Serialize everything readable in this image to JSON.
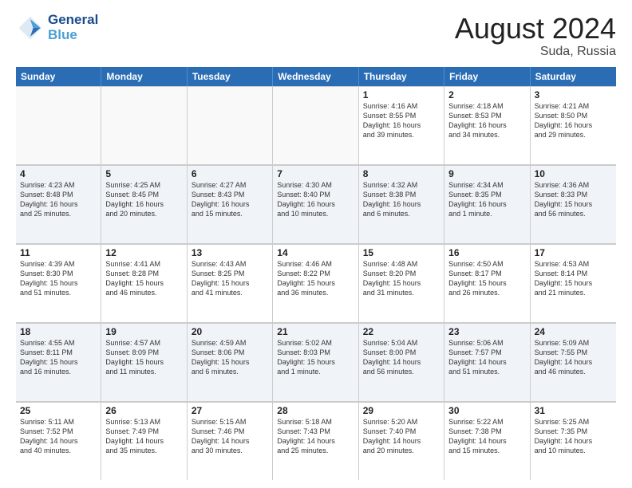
{
  "header": {
    "logo_line1": "General",
    "logo_line2": "Blue",
    "month_title": "August 2024",
    "location": "Suda, Russia"
  },
  "weekdays": [
    "Sunday",
    "Monday",
    "Tuesday",
    "Wednesday",
    "Thursday",
    "Friday",
    "Saturday"
  ],
  "rows": [
    [
      {
        "day": "",
        "info": ""
      },
      {
        "day": "",
        "info": ""
      },
      {
        "day": "",
        "info": ""
      },
      {
        "day": "",
        "info": ""
      },
      {
        "day": "1",
        "info": "Sunrise: 4:16 AM\nSunset: 8:55 PM\nDaylight: 16 hours\nand 39 minutes."
      },
      {
        "day": "2",
        "info": "Sunrise: 4:18 AM\nSunset: 8:53 PM\nDaylight: 16 hours\nand 34 minutes."
      },
      {
        "day": "3",
        "info": "Sunrise: 4:21 AM\nSunset: 8:50 PM\nDaylight: 16 hours\nand 29 minutes."
      }
    ],
    [
      {
        "day": "4",
        "info": "Sunrise: 4:23 AM\nSunset: 8:48 PM\nDaylight: 16 hours\nand 25 minutes."
      },
      {
        "day": "5",
        "info": "Sunrise: 4:25 AM\nSunset: 8:45 PM\nDaylight: 16 hours\nand 20 minutes."
      },
      {
        "day": "6",
        "info": "Sunrise: 4:27 AM\nSunset: 8:43 PM\nDaylight: 16 hours\nand 15 minutes."
      },
      {
        "day": "7",
        "info": "Sunrise: 4:30 AM\nSunset: 8:40 PM\nDaylight: 16 hours\nand 10 minutes."
      },
      {
        "day": "8",
        "info": "Sunrise: 4:32 AM\nSunset: 8:38 PM\nDaylight: 16 hours\nand 6 minutes."
      },
      {
        "day": "9",
        "info": "Sunrise: 4:34 AM\nSunset: 8:35 PM\nDaylight: 16 hours\nand 1 minute."
      },
      {
        "day": "10",
        "info": "Sunrise: 4:36 AM\nSunset: 8:33 PM\nDaylight: 15 hours\nand 56 minutes."
      }
    ],
    [
      {
        "day": "11",
        "info": "Sunrise: 4:39 AM\nSunset: 8:30 PM\nDaylight: 15 hours\nand 51 minutes."
      },
      {
        "day": "12",
        "info": "Sunrise: 4:41 AM\nSunset: 8:28 PM\nDaylight: 15 hours\nand 46 minutes."
      },
      {
        "day": "13",
        "info": "Sunrise: 4:43 AM\nSunset: 8:25 PM\nDaylight: 15 hours\nand 41 minutes."
      },
      {
        "day": "14",
        "info": "Sunrise: 4:46 AM\nSunset: 8:22 PM\nDaylight: 15 hours\nand 36 minutes."
      },
      {
        "day": "15",
        "info": "Sunrise: 4:48 AM\nSunset: 8:20 PM\nDaylight: 15 hours\nand 31 minutes."
      },
      {
        "day": "16",
        "info": "Sunrise: 4:50 AM\nSunset: 8:17 PM\nDaylight: 15 hours\nand 26 minutes."
      },
      {
        "day": "17",
        "info": "Sunrise: 4:53 AM\nSunset: 8:14 PM\nDaylight: 15 hours\nand 21 minutes."
      }
    ],
    [
      {
        "day": "18",
        "info": "Sunrise: 4:55 AM\nSunset: 8:11 PM\nDaylight: 15 hours\nand 16 minutes."
      },
      {
        "day": "19",
        "info": "Sunrise: 4:57 AM\nSunset: 8:09 PM\nDaylight: 15 hours\nand 11 minutes."
      },
      {
        "day": "20",
        "info": "Sunrise: 4:59 AM\nSunset: 8:06 PM\nDaylight: 15 hours\nand 6 minutes."
      },
      {
        "day": "21",
        "info": "Sunrise: 5:02 AM\nSunset: 8:03 PM\nDaylight: 15 hours\nand 1 minute."
      },
      {
        "day": "22",
        "info": "Sunrise: 5:04 AM\nSunset: 8:00 PM\nDaylight: 14 hours\nand 56 minutes."
      },
      {
        "day": "23",
        "info": "Sunrise: 5:06 AM\nSunset: 7:57 PM\nDaylight: 14 hours\nand 51 minutes."
      },
      {
        "day": "24",
        "info": "Sunrise: 5:09 AM\nSunset: 7:55 PM\nDaylight: 14 hours\nand 46 minutes."
      }
    ],
    [
      {
        "day": "25",
        "info": "Sunrise: 5:11 AM\nSunset: 7:52 PM\nDaylight: 14 hours\nand 40 minutes."
      },
      {
        "day": "26",
        "info": "Sunrise: 5:13 AM\nSunset: 7:49 PM\nDaylight: 14 hours\nand 35 minutes."
      },
      {
        "day": "27",
        "info": "Sunrise: 5:15 AM\nSunset: 7:46 PM\nDaylight: 14 hours\nand 30 minutes."
      },
      {
        "day": "28",
        "info": "Sunrise: 5:18 AM\nSunset: 7:43 PM\nDaylight: 14 hours\nand 25 minutes."
      },
      {
        "day": "29",
        "info": "Sunrise: 5:20 AM\nSunset: 7:40 PM\nDaylight: 14 hours\nand 20 minutes."
      },
      {
        "day": "30",
        "info": "Sunrise: 5:22 AM\nSunset: 7:38 PM\nDaylight: 14 hours\nand 15 minutes."
      },
      {
        "day": "31",
        "info": "Sunrise: 5:25 AM\nSunset: 7:35 PM\nDaylight: 14 hours\nand 10 minutes."
      }
    ]
  ]
}
